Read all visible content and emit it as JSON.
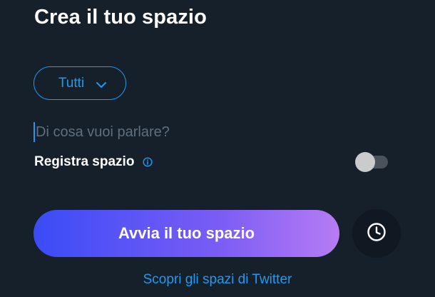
{
  "page": {
    "title": "Crea il tuo spazio"
  },
  "audience_selector": {
    "label": "Tutti",
    "icon": "chevron-down-icon"
  },
  "topic_input": {
    "placeholder": "Di cosa vuoi parlare?",
    "value": ""
  },
  "record": {
    "label": "Registra spazio",
    "info_icon": "info-icon",
    "enabled": false
  },
  "actions": {
    "start_label": "Avvia il tuo spazio",
    "schedule_icon": "clock-icon",
    "discover_link": "Scopri gli spazi di Twitter"
  },
  "colors": {
    "background": "#15202b",
    "accent": "#1d9bf0",
    "gradient_start": "#3a4cf6",
    "gradient_end": "#b67cf3"
  }
}
